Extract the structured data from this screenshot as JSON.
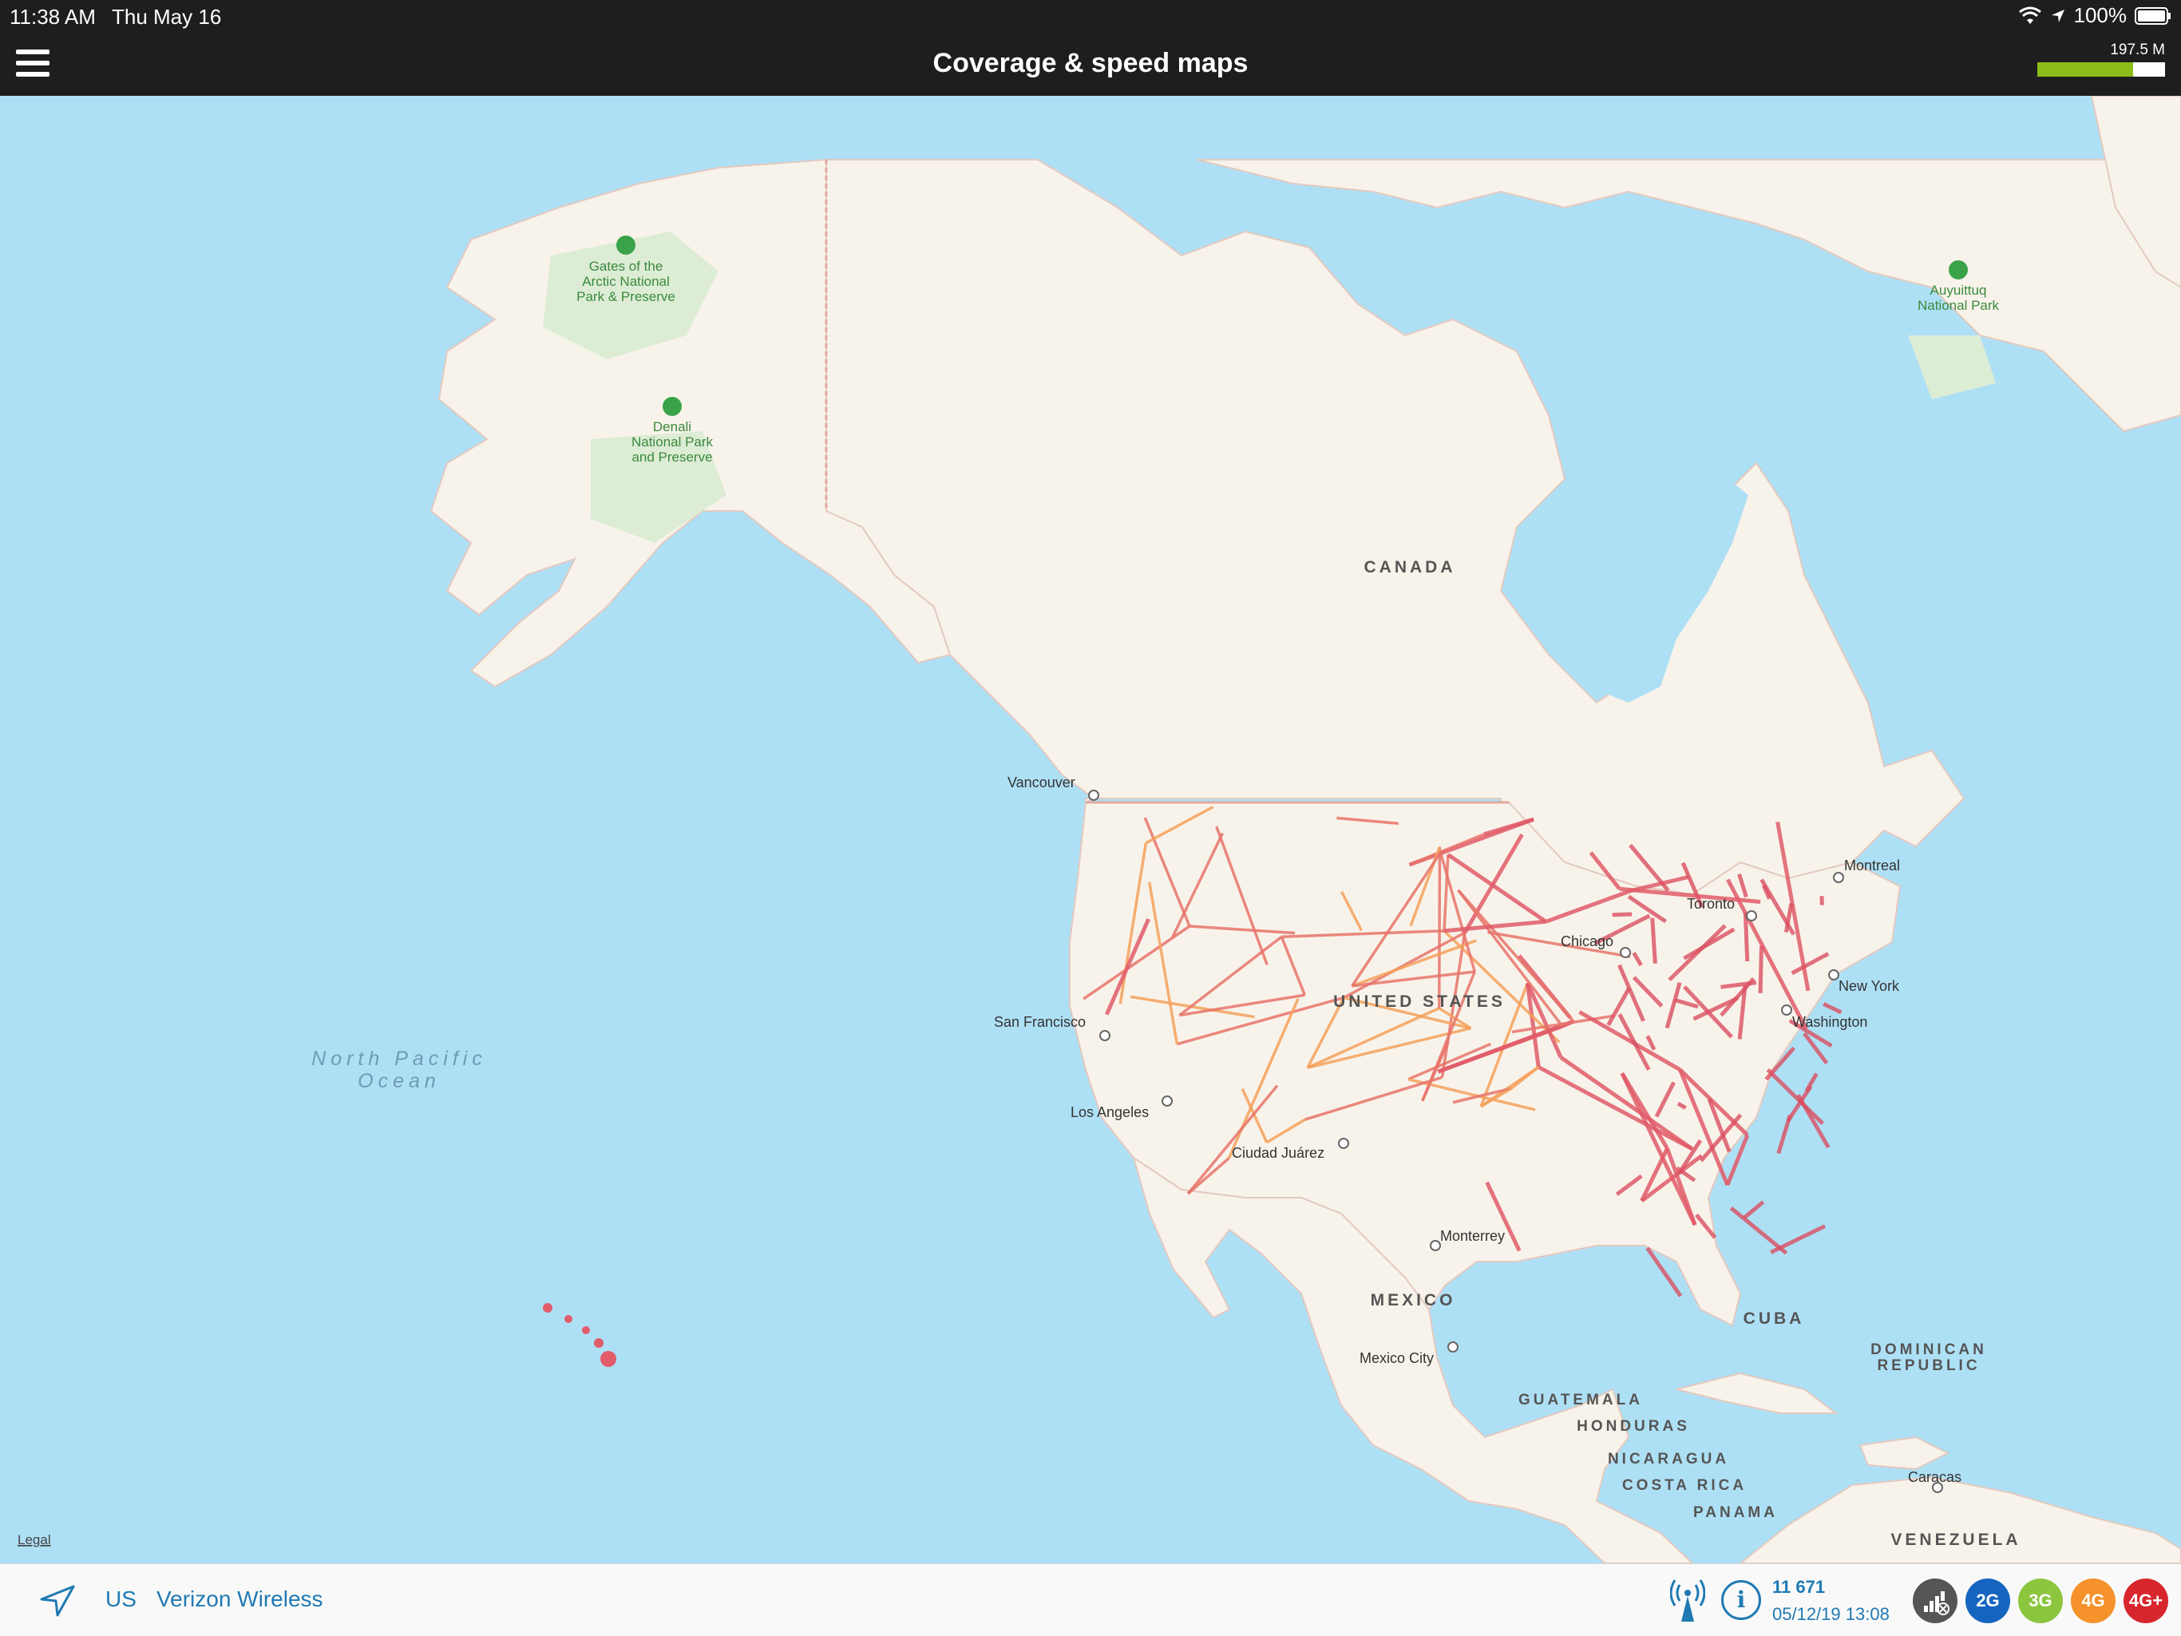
{
  "status": {
    "time": "11:38 AM",
    "date": "Thu May 16",
    "battery": "100%"
  },
  "header": {
    "title": "Coverage & speed maps",
    "data_used": "197.5 M",
    "data_fraction": 0.75
  },
  "map": {
    "labels": {
      "canada": "CANADA",
      "united_states": "UNITED STATES",
      "mexico": "MEXICO",
      "cuba": "CUBA",
      "dominican_republic_1": "DOMINICAN",
      "dominican_republic_2": "REPUBLIC",
      "guatemala": "GUATEMALA",
      "honduras": "HONDURAS",
      "nicaragua": "NICARAGUA",
      "costa_rica": "COSTA RICA",
      "panama": "PANAMA",
      "venezuela": "VENEZUELA",
      "ocean_1": "North Pacific",
      "ocean_2": "Ocean"
    },
    "parks": {
      "gates_1": "Gates of the",
      "gates_2": "Arctic National",
      "gates_3": "Park & Preserve",
      "denali_1": "Denali",
      "denali_2": "National Park",
      "denali_3": "and Preserve",
      "auyuittuq_1": "Auyuittuq",
      "auyuittuq_2": "National Park"
    },
    "cities": {
      "vancouver": "Vancouver",
      "san_francisco": "San Francisco",
      "los_angeles": "Los Angeles",
      "ciudad_juarez": "Ciudad Juárez",
      "monterrey": "Monterrey",
      "mexico_city": "Mexico City",
      "chicago": "Chicago",
      "toronto": "Toronto",
      "montreal": "Montreal",
      "new_york": "New York",
      "washington": "Washington",
      "caracas": "Caracas"
    },
    "legal": "Legal"
  },
  "footer": {
    "country": "US",
    "operator": "Verizon Wireless",
    "count": "11 671",
    "datetime": "05/12/19 13:08",
    "filters": [
      "2G",
      "3G",
      "4G",
      "4G+"
    ],
    "colors": {
      "2g": "#1565c0",
      "3g": "#8cc63f",
      "4g": "#f5922b",
      "4gplus": "#d7262e",
      "all": "#555555"
    }
  }
}
